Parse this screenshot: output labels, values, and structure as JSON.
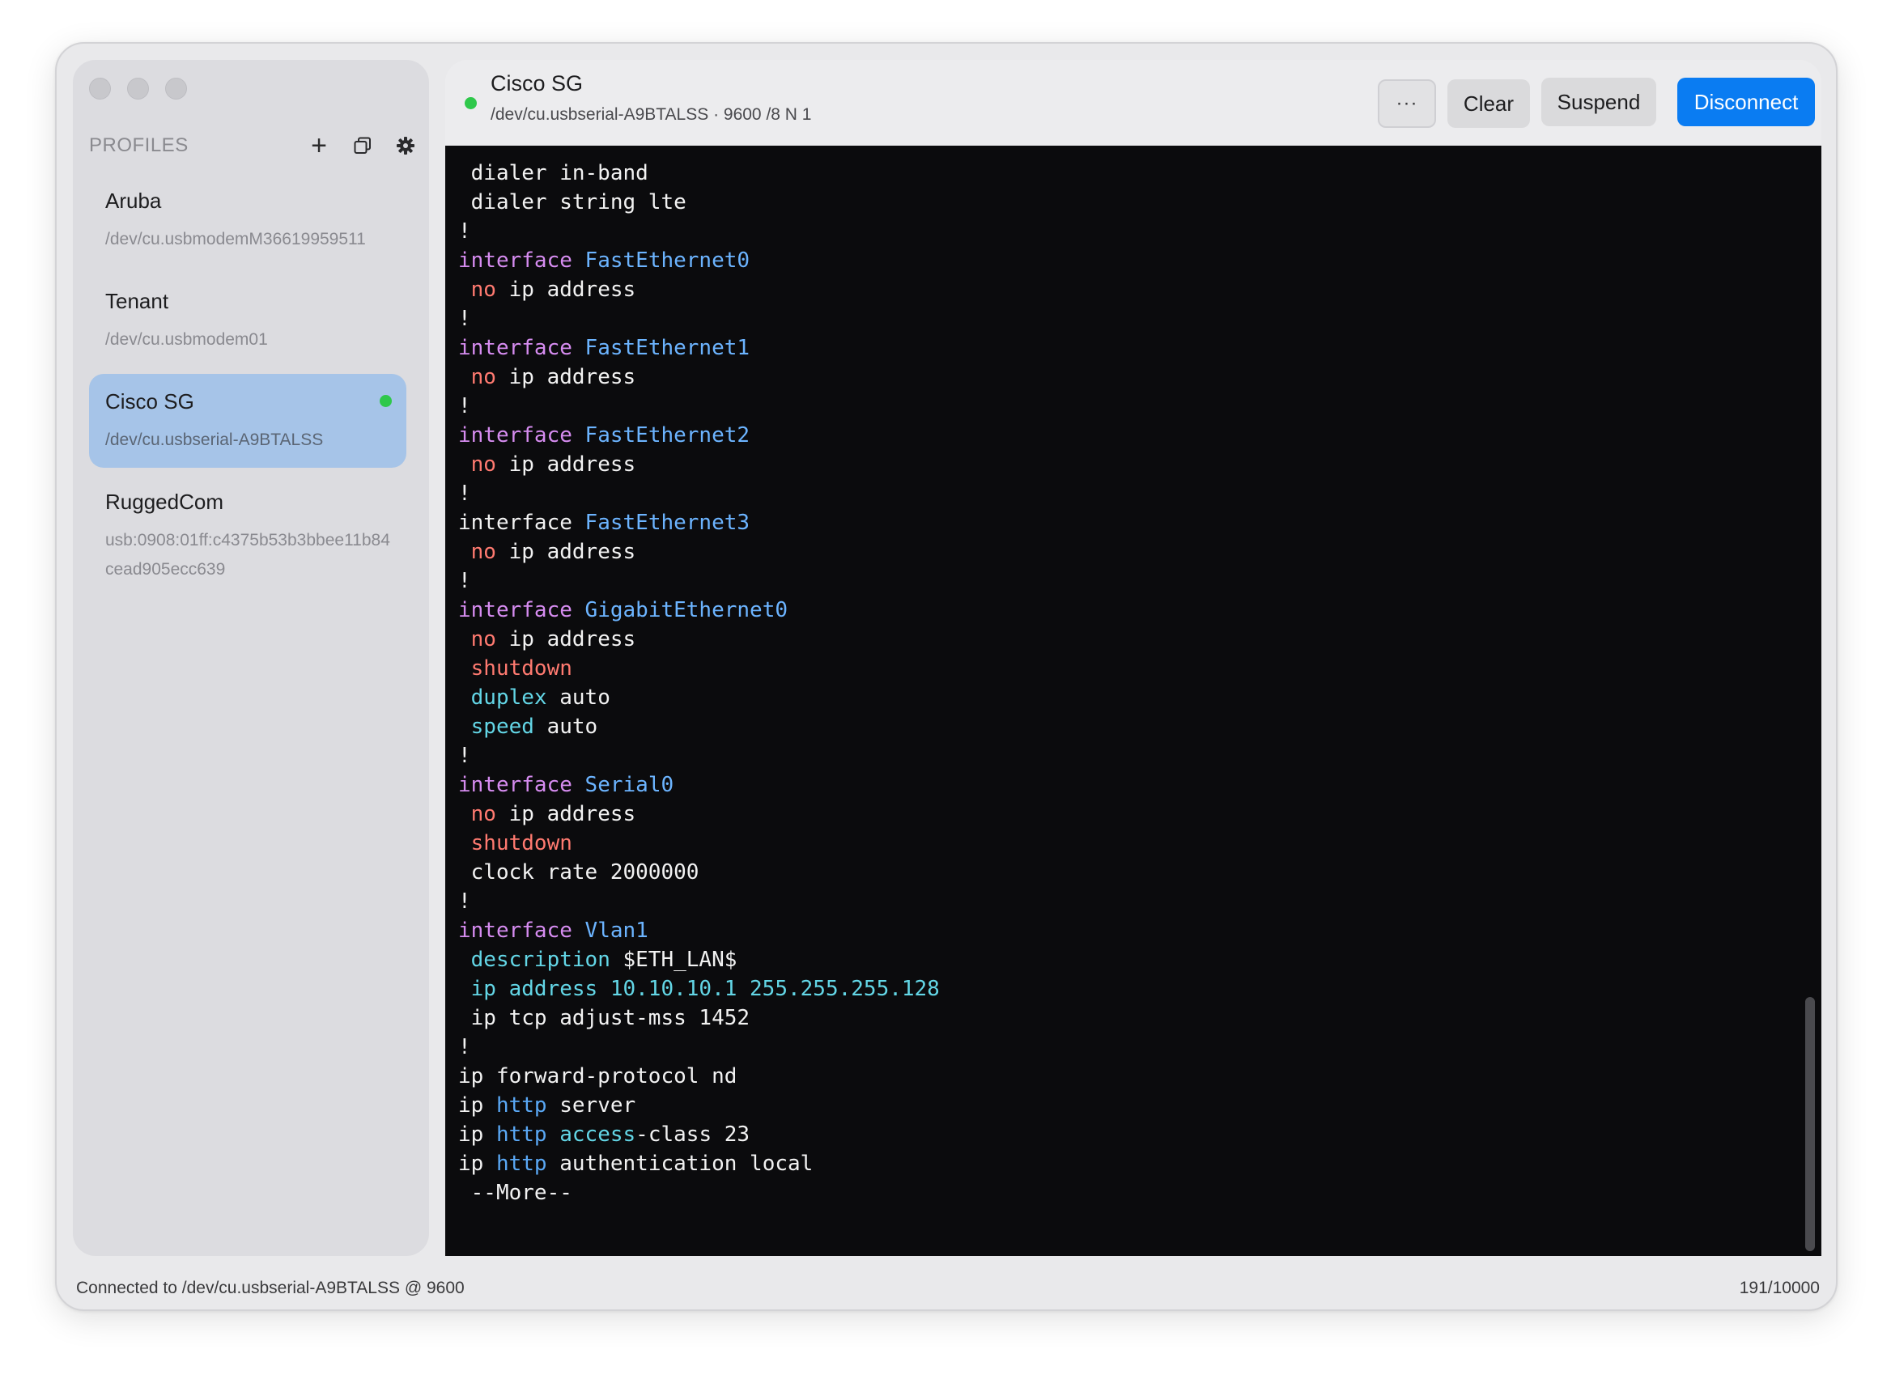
{
  "sidebar": {
    "header": "PROFILES",
    "icons": {
      "add": "+",
      "duplicate": "⧉",
      "settings": "⚙"
    },
    "profiles": [
      {
        "name": "Aruba",
        "path": "/dev/cu.usbmodemM36619959511",
        "selected": false,
        "connected": false
      },
      {
        "name": "Tenant",
        "path": "/dev/cu.usbmodem01",
        "selected": false,
        "connected": false
      },
      {
        "name": "Cisco SG",
        "path": "/dev/cu.usbserial-A9BTALSS",
        "selected": true,
        "connected": true
      },
      {
        "name": "RuggedCom",
        "path": "usb:0908:01ff:c4375b53b3bbee11b84cead905ecc639",
        "selected": false,
        "connected": false
      }
    ]
  },
  "toolbar": {
    "title": "Cisco SG",
    "subtitle": "/dev/cu.usbserial-A9BTALSS · 9600 /8 N 1",
    "more_label": "···",
    "clear_label": "Clear",
    "suspend_label": "Suspend",
    "disconnect_label": "Disconnect"
  },
  "terminal": {
    "lines": [
      [
        {
          "t": " dialer in-band"
        }
      ],
      [
        {
          "t": " dialer string lte"
        }
      ],
      [
        {
          "t": "!"
        }
      ],
      [
        {
          "t": "interface ",
          "c": "kw"
        },
        {
          "t": "FastEthernet0",
          "c": "if"
        }
      ],
      [
        {
          "t": " "
        },
        {
          "t": "no",
          "c": "no"
        },
        {
          "t": " ip address"
        }
      ],
      [
        {
          "t": "!"
        }
      ],
      [
        {
          "t": "interface ",
          "c": "kw"
        },
        {
          "t": "FastEthernet1",
          "c": "if"
        }
      ],
      [
        {
          "t": " "
        },
        {
          "t": "no",
          "c": "no"
        },
        {
          "t": " ip address"
        }
      ],
      [
        {
          "t": "!"
        }
      ],
      [
        {
          "t": "interface ",
          "c": "kw"
        },
        {
          "t": "FastEthernet2",
          "c": "if"
        }
      ],
      [
        {
          "t": " "
        },
        {
          "t": "no",
          "c": "no"
        },
        {
          "t": " ip address"
        }
      ],
      [
        {
          "t": "!"
        }
      ],
      [
        {
          "t": "interface "
        },
        {
          "t": "FastEthernet3",
          "c": "if"
        }
      ],
      [
        {
          "t": " "
        },
        {
          "t": "no",
          "c": "no"
        },
        {
          "t": " ip address"
        }
      ],
      [
        {
          "t": "!"
        }
      ],
      [
        {
          "t": "interface ",
          "c": "kw"
        },
        {
          "t": "GigabitEthernet0",
          "c": "if"
        }
      ],
      [
        {
          "t": " "
        },
        {
          "t": "no",
          "c": "no"
        },
        {
          "t": " ip address"
        }
      ],
      [
        {
          "t": " "
        },
        {
          "t": "shutdown",
          "c": "no"
        }
      ],
      [
        {
          "t": " "
        },
        {
          "t": "duplex",
          "c": "cy"
        },
        {
          "t": " auto"
        }
      ],
      [
        {
          "t": " "
        },
        {
          "t": "speed",
          "c": "cy"
        },
        {
          "t": " auto"
        }
      ],
      [
        {
          "t": "!"
        }
      ],
      [
        {
          "t": "interface ",
          "c": "kw"
        },
        {
          "t": "Serial0",
          "c": "if"
        }
      ],
      [
        {
          "t": " "
        },
        {
          "t": "no",
          "c": "no"
        },
        {
          "t": " ip address"
        }
      ],
      [
        {
          "t": " "
        },
        {
          "t": "shutdown",
          "c": "no"
        }
      ],
      [
        {
          "t": " clock rate 2000000"
        }
      ],
      [
        {
          "t": "!"
        }
      ],
      [
        {
          "t": "interface ",
          "c": "kw"
        },
        {
          "t": "Vlan1",
          "c": "if"
        }
      ],
      [
        {
          "t": " "
        },
        {
          "t": "description",
          "c": "cy"
        },
        {
          "t": " $ETH_LAN$"
        }
      ],
      [
        {
          "t": " "
        },
        {
          "t": "ip address 10.10.10.1 255.255.255.128",
          "c": "cy"
        }
      ],
      [
        {
          "t": " ip tcp adjust-mss 1452"
        }
      ],
      [
        {
          "t": "!"
        }
      ],
      [
        {
          "t": "ip forward-protocol nd"
        }
      ],
      [
        {
          "t": "ip "
        },
        {
          "t": "http",
          "c": "bl"
        },
        {
          "t": " server"
        }
      ],
      [
        {
          "t": "ip "
        },
        {
          "t": "http",
          "c": "bl"
        },
        {
          "t": " "
        },
        {
          "t": "access",
          "c": "cy"
        },
        {
          "t": "-class 23"
        }
      ],
      [
        {
          "t": "ip "
        },
        {
          "t": "http",
          "c": "bl"
        },
        {
          "t": " authentication local"
        }
      ],
      [
        {
          "t": " --More--"
        }
      ]
    ]
  },
  "status": {
    "left": "Connected to /dev/cu.usbserial-A9BTALSS @ 9600",
    "right": "191/10000"
  },
  "colors": {
    "accent": "#0a7cf2",
    "selected_profile_bg": "#a6c4e8",
    "connected_dot": "#2fc84b",
    "terminal_bg": "#0b0b0d"
  }
}
